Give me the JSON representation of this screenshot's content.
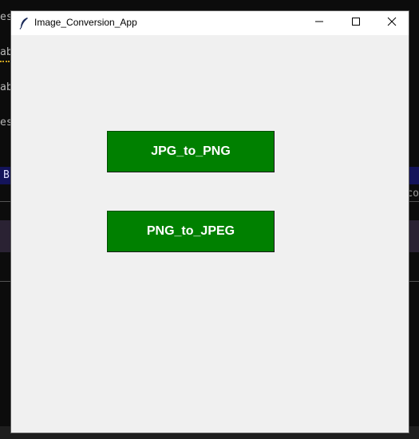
{
  "window": {
    "title": "Image_Conversion_App",
    "icon": "feather-icon",
    "controls": {
      "minimize": "minimize-icon",
      "maximize": "maximize-icon",
      "close": "close-icon"
    }
  },
  "buttons": {
    "jpg_to_png": "JPG_to_PNG",
    "png_to_jpeg": "PNG_to_JPEG"
  },
  "background": {
    "lines": [
      "es",
      "ab",
      "ab",
      "es"
    ],
    "blue_bar_glyph": "B",
    "right_text": "co"
  },
  "colors": {
    "button_bg": "#008000",
    "button_text": "#ffffff",
    "window_bg": "#f0f0f0",
    "titlebar_bg": "#ffffff"
  }
}
